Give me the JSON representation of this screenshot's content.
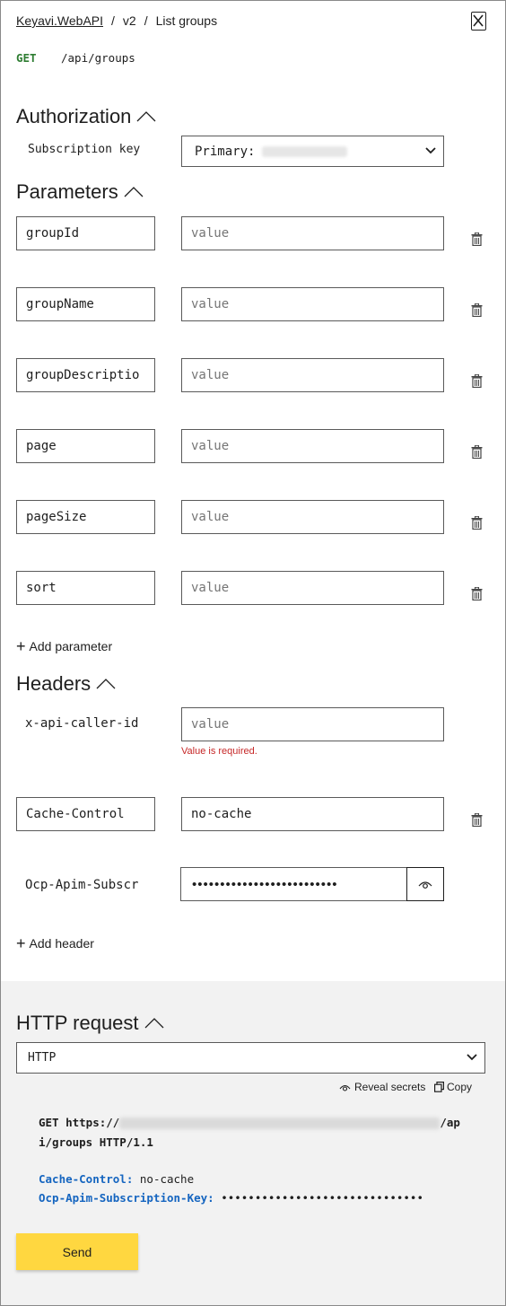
{
  "breadcrumb": {
    "api": "Keyavi.WebAPI",
    "version": "v2",
    "operation": "List groups",
    "separator": "/"
  },
  "request_line": {
    "method": "GET",
    "path": "/api/groups"
  },
  "authorization": {
    "title": "Authorization",
    "subscription_label": "Subscription key",
    "subscription_selected": "Primary:"
  },
  "parameters": {
    "title": "Parameters",
    "value_placeholder": "value",
    "items": [
      {
        "name": "groupId",
        "value": ""
      },
      {
        "name": "groupName",
        "value": ""
      },
      {
        "name": "groupDescriptio",
        "value": ""
      },
      {
        "name": "page",
        "value": ""
      },
      {
        "name": "pageSize",
        "value": ""
      },
      {
        "name": "sort",
        "value": ""
      }
    ],
    "add_label": "Add parameter"
  },
  "headers": {
    "title": "Headers",
    "caller_id": {
      "name": "x-api-caller-id",
      "placeholder": "value",
      "error": "Value is required."
    },
    "cache_control": {
      "name": "Cache-Control",
      "value": "no-cache"
    },
    "subscription": {
      "name": "Ocp-Apim-Subscr",
      "masked_value": "••••••••••••••••••••••••••"
    },
    "add_label": "Add header"
  },
  "http_request": {
    "title": "HTTP request",
    "format_selected": "HTTP",
    "reveal_label": "Reveal secrets",
    "copy_label": "Copy",
    "line1_prefix": "GET https://",
    "line1_suffix": "/ap",
    "line2": "i/groups HTTP/1.1",
    "header1_key": "Cache-Control:",
    "header1_value": "no-cache",
    "header2_key": "Ocp-Apim-Subscription-Key:",
    "header2_value": "••••••••••••••••••••••••••••••"
  },
  "send_label": "Send",
  "colors": {
    "accent_yellow": "#ffd740",
    "method_green": "#2e7d32",
    "error_red": "#c62828",
    "header_key_blue": "#1565c0"
  }
}
